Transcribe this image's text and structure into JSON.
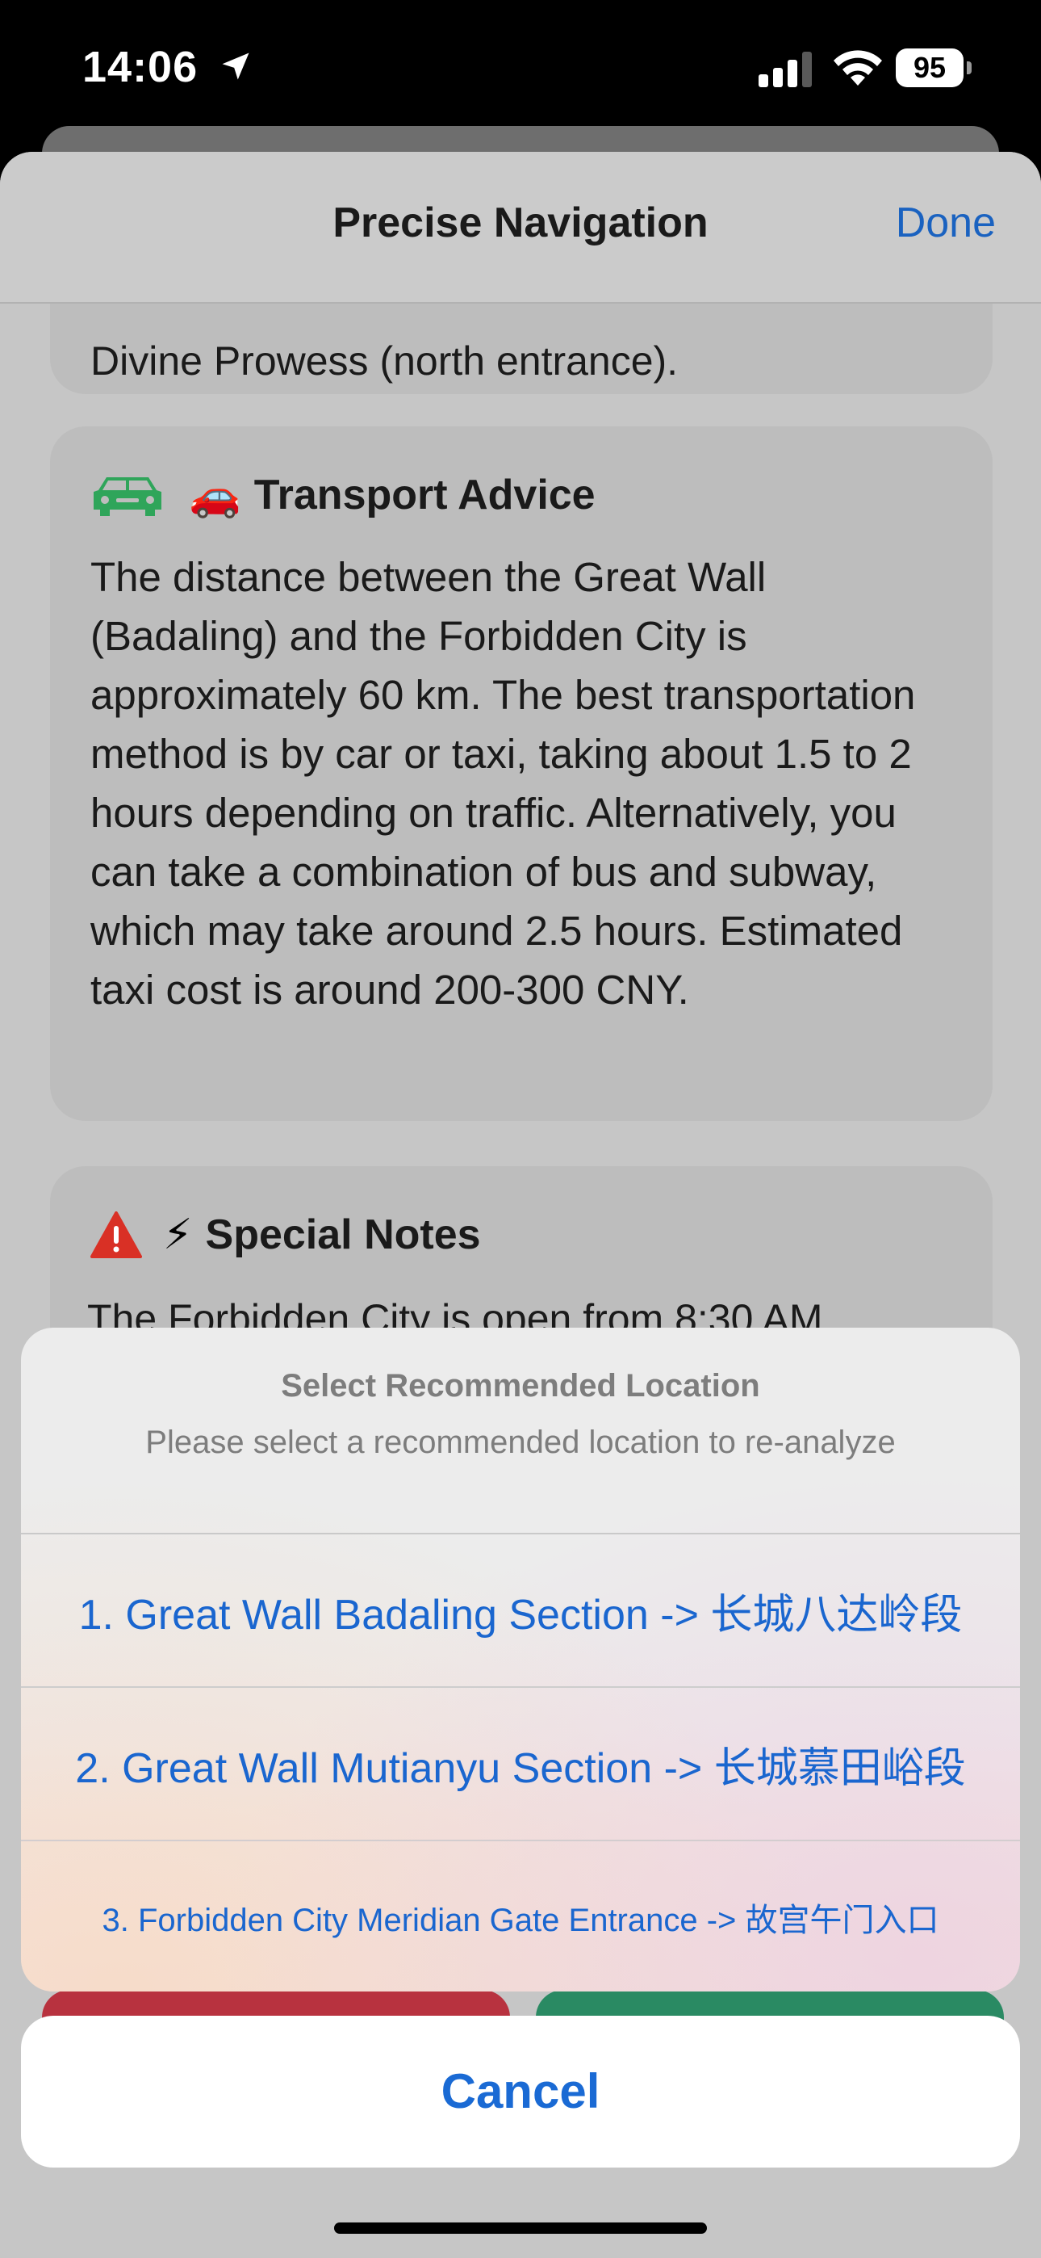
{
  "status_bar": {
    "time": "14:06",
    "battery": "95"
  },
  "nav": {
    "title": "Precise Navigation",
    "done_label": "Done"
  },
  "cards": {
    "top_tail": "Divine Prowess (north entrance).",
    "transport": {
      "title": "Transport Advice",
      "emoji": "🚗",
      "body": "The distance between the Great Wall (Badaling) and the Forbidden City is approximately 60 km. The best transportation method is by car or taxi, taking about 1.5 to 2 hours depending on traffic. Alternatively, you can take a combination of bus and subway, which may take around 2.5 hours. Estimated taxi cost is around 200-300 CNY."
    },
    "notes": {
      "title": "Special Notes",
      "emoji": "⚡",
      "body": "The Forbidden City is open from 8:30 AM"
    }
  },
  "action_sheet": {
    "title": "Select Recommended Location",
    "message": "Please select a recommended location to re-analyze",
    "options": [
      "1. Great Wall Badaling Section -> 长城八达岭段",
      "2. Great Wall Mutianyu Section -> 长城慕田峪段",
      "3. Forbidden City Meridian Gate Entrance -> 故宫午门入口"
    ],
    "cancel_label": "Cancel"
  },
  "icons": {
    "car": "car-icon",
    "warning": "warning-icon",
    "location": "location-arrow-icon"
  },
  "colors": {
    "accent": "#1a66cf",
    "car_green": "#34a853",
    "warning_red": "#d93025"
  }
}
